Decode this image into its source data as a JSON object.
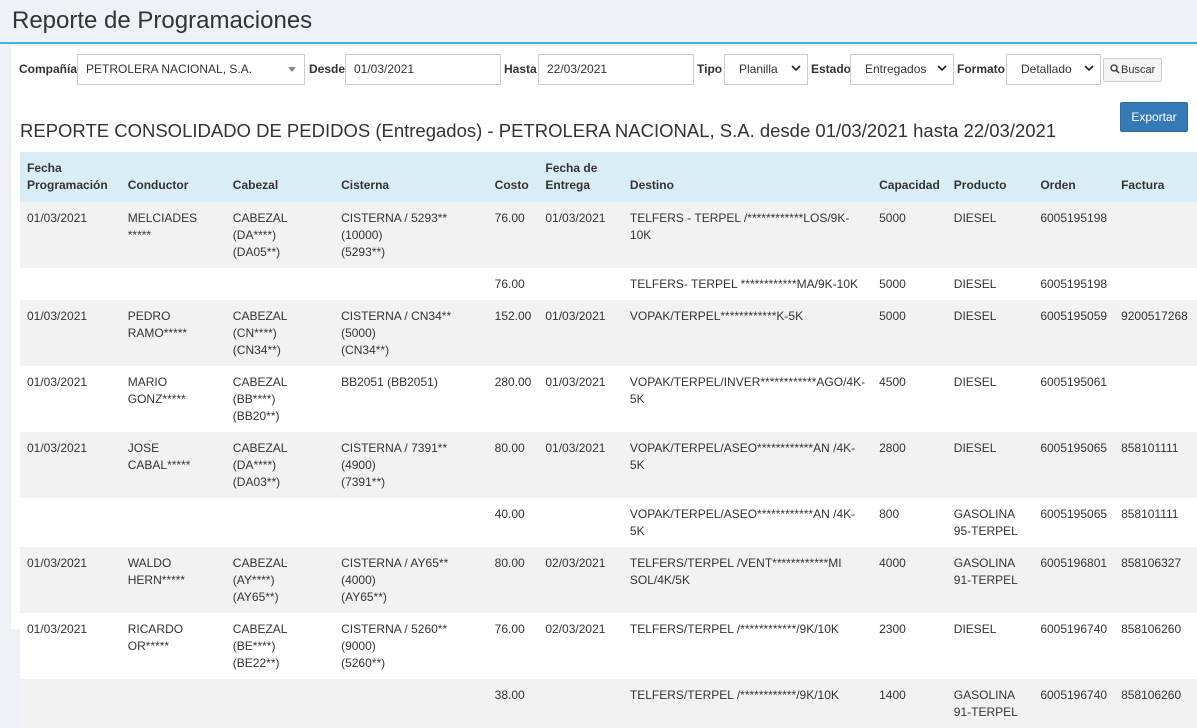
{
  "page_title": "Reporte de Programaciones",
  "filters": {
    "company_label": "Compañía",
    "company_value": "PETROLERA NACIONAL, S.A.",
    "from_label": "Desde",
    "from_value": "01/03/2021",
    "to_label": "Hasta",
    "to_value": "22/03/2021",
    "type_label": "Tipo",
    "type_value": "Planilla",
    "status_label": "Estado",
    "status_value": "Entregados",
    "format_label": "Formato",
    "format_value": "Detallado",
    "search_label": "Buscar"
  },
  "export_label": "Exportar",
  "report_title": "REPORTE CONSOLIDADO DE PEDIDOS (Entregados) - PETROLERA NACIONAL, S.A. desde 01/03/2021 hasta 22/03/2021",
  "table": {
    "headers": [
      "Fecha\nProgramación",
      "Conductor",
      "Cabezal",
      "Cisterna",
      "Costo",
      "Fecha de\nEntrega",
      "Destino",
      "Capacidad",
      "Producto",
      "Orden",
      "Factura"
    ],
    "rows": [
      [
        "01/03/2021",
        "MELCIADES *****",
        "CABEZAL (DA****)\n(DA05**)",
        "CISTERNA / 5293** (10000)\n(5293**)",
        "76.00",
        "01/03/2021",
        "TELFERS - TERPEL /************LOS/9K-10K",
        "5000",
        "DIESEL",
        "6005195198",
        ""
      ],
      [
        "",
        "",
        "",
        "",
        "76.00",
        "",
        "TELFERS- TERPEL ************MA/9K-10K",
        "5000",
        "DIESEL",
        "6005195198",
        ""
      ],
      [
        "01/03/2021",
        "PEDRO\nRAMO*****",
        "CABEZAL (CN****)\n(CN34**)",
        "CISTERNA / CN34** (5000)\n(CN34**)",
        "152.00",
        "01/03/2021",
        "VOPAK/TERPEL************K-5K",
        "5000",
        "DIESEL",
        "6005195059",
        "9200517268"
      ],
      [
        "01/03/2021",
        "MARIO\nGONZ*****",
        "CABEZAL (BB****)\n(BB20**)",
        "BB2051 (BB2051)",
        "280.00",
        "01/03/2021",
        "VOPAK/TERPEL/INVER************AGO/4K-\n5K",
        "4500",
        "DIESEL",
        "6005195061",
        ""
      ],
      [
        "01/03/2021",
        "JOSE CABAL*****",
        "CABEZAL (DA****)\n(DA03**)",
        "CISTERNA / 7391** (4900)\n(7391**)",
        "80.00",
        "01/03/2021",
        "VOPAK/TERPEL/ASEO************AN /4K-5K",
        "2800",
        "DIESEL",
        "6005195065",
        "858101111"
      ],
      [
        "",
        "",
        "",
        "",
        "40.00",
        "",
        "VOPAK/TERPEL/ASEO************AN /4K-5K",
        "800",
        "GASOLINA\n95-TERPEL",
        "6005195065",
        "858101111"
      ],
      [
        "01/03/2021",
        "WALDO\nHERN*****",
        "CABEZAL (AY****)\n(AY65**)",
        "CISTERNA / AY65** (4000)\n(AY65**)",
        "80.00",
        "02/03/2021",
        "TELFERS/TERPEL /VENT************MI\nSOL/4K/5K",
        "4000",
        "GASOLINA\n91-TERPEL",
        "6005196801",
        "858106327"
      ],
      [
        "01/03/2021",
        "RICARDO\nOR*****",
        "CABEZAL (BE****)\n(BE22**)",
        "CISTERNA / 5260** (9000)\n(5260**)",
        "76.00",
        "02/03/2021",
        "TELFERS/TERPEL /************/9K/10K",
        "2300",
        "DIESEL",
        "6005196740",
        "858106260"
      ],
      [
        "",
        "",
        "",
        "",
        "38.00",
        "",
        "TELFERS/TERPEL /************/9K/10K",
        "1400",
        "GASOLINA\n91-TERPEL",
        "6005196740",
        "858106260"
      ]
    ]
  }
}
